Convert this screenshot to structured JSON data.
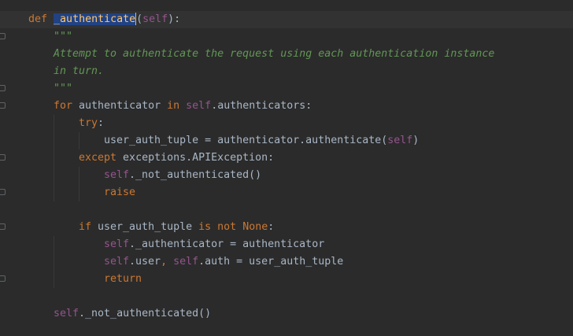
{
  "editor": {
    "language": "python",
    "theme_colors": {
      "background": "#2b2b2b",
      "keyword": "#cc7832",
      "self": "#94558d",
      "function_name": "#ffc66d",
      "docstring": "#629755",
      "default": "#a9b7c6",
      "selection": "#214283"
    },
    "lines": {
      "l1": {
        "def": "def",
        "name": "_authenticate",
        "open": "(",
        "self": "self",
        "close": "):"
      },
      "l2": {
        "text": "\"\"\""
      },
      "l3": {
        "text": "Attempt to authenticate the request using each authentication instance"
      },
      "l4": {
        "text": "in turn."
      },
      "l5": {
        "text": "\"\"\""
      },
      "l6": {
        "for": "for",
        "var": " authenticator ",
        "in": "in",
        "self": "self",
        "rest": ".authenticators:"
      },
      "l7": {
        "try": "try",
        "colon": ":"
      },
      "l8": {
        "a": "user_auth_tuple = authenticator.authenticate(",
        "self": "self",
        "b": ")"
      },
      "l9": {
        "except": "except",
        "rest": " exceptions.APIException:"
      },
      "l10": {
        "self": "self",
        "rest": "._not_authenticated()"
      },
      "l11": {
        "raise": "raise"
      },
      "l12": {},
      "l13": {
        "if": "if",
        "var": " user_auth_tuple ",
        "is": "is",
        "not": "not",
        "none": "None",
        "colon": ":"
      },
      "l14": {
        "self": "self",
        "rest": "._authenticator = authenticator"
      },
      "l15": {
        "self1": "self",
        "mid": ".user",
        "comma": ",",
        "self2": "self",
        "rest": ".auth = user_auth_tuple"
      },
      "l16": {
        "return": "return"
      },
      "l17": {},
      "l18": {
        "self": "self",
        "rest": "._not_authenticated()"
      }
    }
  }
}
